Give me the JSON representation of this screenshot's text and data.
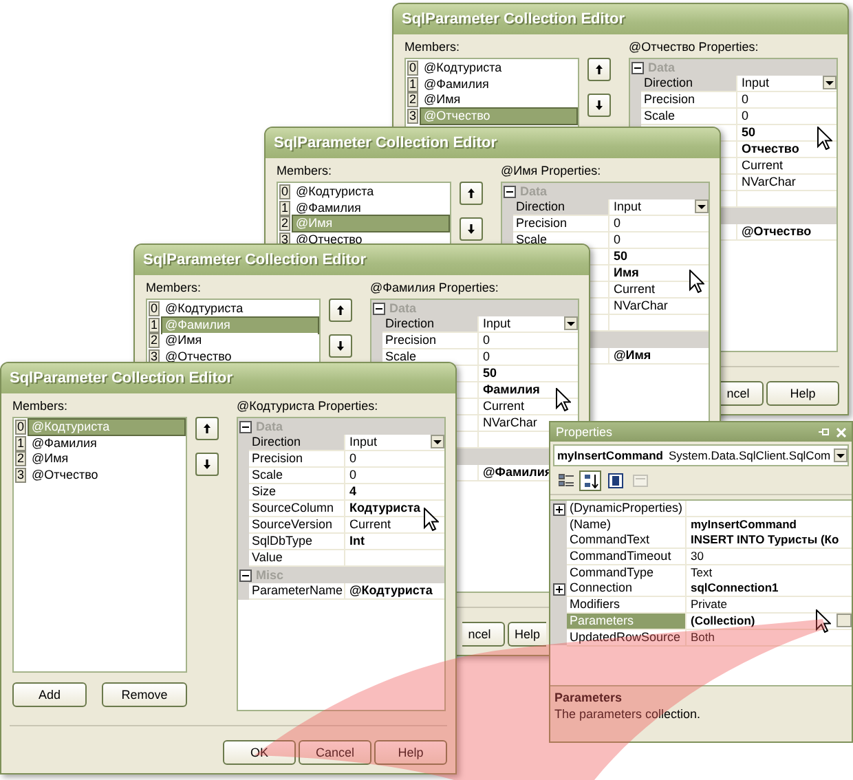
{
  "editors": [
    {
      "title": "SqlParameter Collection Editor",
      "members_label": "Members:",
      "members": [
        {
          "index": "0",
          "name": "@Кодтуриста",
          "selected": false
        },
        {
          "index": "1",
          "name": "@Фамилия",
          "selected": false
        },
        {
          "index": "2",
          "name": "@Имя",
          "selected": false
        },
        {
          "index": "3",
          "name": "@Отчество",
          "selected": true
        }
      ],
      "properties_label": "@Отчество Properties:",
      "grid": [
        {
          "kind": "category",
          "name": "Data",
          "expanded": true
        },
        {
          "kind": "dropdown",
          "name": "Direction",
          "value": "Input",
          "bold": false,
          "selected": true
        },
        {
          "kind": "property",
          "name": "Precision",
          "value": "0",
          "bold": false,
          "selected": false
        },
        {
          "kind": "property",
          "name": "Scale",
          "value": "0",
          "bold": false,
          "selected": false
        },
        {
          "kind": "property",
          "value": "50",
          "bold": true,
          "selected": false
        },
        {
          "kind": "property",
          "value": "Отчество",
          "bold": true,
          "selected": false
        },
        {
          "kind": "property",
          "value": "Current",
          "bold": false,
          "selected": false
        },
        {
          "kind": "property",
          "value": "NVarChar",
          "bold": false,
          "selected": false
        },
        {
          "kind": "property",
          "selected": false
        },
        {
          "kind": "category"
        },
        {
          "kind": "property",
          "value": "@Отчество",
          "bold": true,
          "selected": false
        }
      ],
      "buttons": [
        {
          "label": "ncel",
          "hidden_start": true,
          "hidden_end": false
        },
        {
          "label": "Help",
          "hidden_start": false,
          "hidden_end": false
        }
      ]
    },
    {
      "title": "SqlParameter Collection Editor",
      "members_label": "Members:",
      "members": [
        {
          "index": "0",
          "name": "@Кодтуриста",
          "selected": false
        },
        {
          "index": "1",
          "name": "@Фамилия",
          "selected": false
        },
        {
          "index": "2",
          "name": "@Имя",
          "selected": true
        },
        {
          "index": "3",
          "name": "@Отчество",
          "selected": false
        }
      ],
      "properties_label": "@Имя Properties:",
      "grid": [
        {
          "kind": "category",
          "name": "Data",
          "expanded": true
        },
        {
          "kind": "dropdown",
          "name": "Direction",
          "value": "Input",
          "bold": false,
          "selected": true
        },
        {
          "kind": "property",
          "name": "Precision",
          "value": "0",
          "bold": false,
          "selected": false
        },
        {
          "kind": "property",
          "name": "Scale",
          "value": "0",
          "bold": false,
          "selected": false
        },
        {
          "kind": "property",
          "value": "50",
          "bold": true,
          "selected": false
        },
        {
          "kind": "property",
          "value": "Имя",
          "bold": true,
          "selected": false
        },
        {
          "kind": "property",
          "value": "Current",
          "bold": false,
          "selected": false
        },
        {
          "kind": "property",
          "value": "NVarChar",
          "bold": false,
          "selected": false
        },
        {
          "kind": "property",
          "selected": false
        },
        {
          "kind": "category"
        },
        {
          "kind": "property",
          "value": "@Имя",
          "bold": true,
          "selected": false
        }
      ]
    },
    {
      "title": "SqlParameter Collection Editor",
      "members_label": "Members:",
      "members": [
        {
          "index": "0",
          "name": "@Кодтуриста",
          "selected": false
        },
        {
          "index": "1",
          "name": "@Фамилия",
          "selected": true
        },
        {
          "index": "2",
          "name": "@Имя",
          "selected": false
        },
        {
          "index": "3",
          "name": "@Отчество",
          "selected": false
        }
      ],
      "properties_label": "@Фамилия Properties:",
      "grid": [
        {
          "kind": "category",
          "name": "Data",
          "expanded": true
        },
        {
          "kind": "dropdown",
          "name": "Direction",
          "value": "Input",
          "bold": false,
          "selected": true
        },
        {
          "kind": "property",
          "name": "Precision",
          "value": "0",
          "bold": false,
          "selected": false
        },
        {
          "kind": "property",
          "name": "Scale",
          "value": "0",
          "bold": false,
          "selected": false
        },
        {
          "kind": "property",
          "value": "50",
          "bold": true,
          "selected": false
        },
        {
          "kind": "property",
          "value": "Фамилия",
          "bold": true,
          "selected": false
        },
        {
          "kind": "property",
          "value": "Current",
          "bold": false,
          "selected": false
        },
        {
          "kind": "property",
          "value": "NVarChar",
          "bold": false,
          "selected": false
        },
        {
          "kind": "property",
          "selected": false
        },
        {
          "kind": "category"
        },
        {
          "kind": "property",
          "value": "@Фамилия",
          "bold": true,
          "selected": false
        }
      ],
      "buttons": [
        {
          "label": "ncel",
          "hidden_start": true,
          "hidden_end": false
        },
        {
          "label": "Help",
          "hidden_start": false,
          "hidden_end": true
        }
      ]
    },
    {
      "title": "SqlParameter Collection Editor",
      "members_label": "Members:",
      "members": [
        {
          "index": "0",
          "name": "@Кодтуриста",
          "selected": true
        },
        {
          "index": "1",
          "name": "@Фамилия",
          "selected": false
        },
        {
          "index": "2",
          "name": "@Имя",
          "selected": false
        },
        {
          "index": "3",
          "name": "@Отчество",
          "selected": false
        }
      ],
      "list_buttons": [
        "Add",
        "Remove"
      ],
      "properties_label": "@Кодтуриста Properties:",
      "grid": [
        {
          "kind": "category",
          "name": "Data",
          "expanded": true
        },
        {
          "kind": "dropdown",
          "name": "Direction",
          "value": "Input",
          "bold": false,
          "selected": true
        },
        {
          "kind": "property",
          "name": "Precision",
          "value": "0",
          "bold": false,
          "selected": false
        },
        {
          "kind": "property",
          "name": "Scale",
          "value": "0",
          "bold": false,
          "selected": false
        },
        {
          "kind": "property",
          "name": "Size",
          "value": "4",
          "bold": true,
          "selected": false
        },
        {
          "kind": "property",
          "name": "SourceColumn",
          "value": "Кодтуриста",
          "bold": true,
          "selected": false
        },
        {
          "kind": "property",
          "name": "SourceVersion",
          "value": "Current",
          "bold": false,
          "selected": false
        },
        {
          "kind": "property",
          "name": "SqlDbType",
          "value": "Int",
          "bold": true,
          "selected": false
        },
        {
          "kind": "property",
          "name": "Value",
          "selected": false
        },
        {
          "kind": "category",
          "name": "Misc",
          "expanded": true
        },
        {
          "kind": "property",
          "name": "ParameterName",
          "value": "@Кодтуриста",
          "bold": true,
          "selected": false
        }
      ],
      "buttons": [
        {
          "label": "OK",
          "hidden_start": false,
          "hidden_end": false
        },
        {
          "label": "Cancel",
          "hidden_start": false,
          "hidden_end": false
        },
        {
          "label": "Help",
          "hidden_start": false,
          "hidden_end": false
        }
      ]
    }
  ],
  "properties_window": {
    "title": "Properties",
    "object_name": "myInsertCommand",
    "object_type": "System.Data.SqlClient.SqlCom",
    "toolbar": [
      {
        "kind": "categorized",
        "selected": false,
        "disabled": false
      },
      {
        "kind": "alphabetical",
        "selected": true,
        "disabled": false
      },
      {
        "kind": "properties",
        "selected": false,
        "disabled": false
      },
      {
        "kind": "events",
        "selected": false,
        "disabled": true
      }
    ],
    "rows": [
      {
        "kind": "property",
        "name": "(DynamicProperties)",
        "bold": false,
        "expandable": true,
        "selected": false
      },
      {
        "kind": "property",
        "name": "(Name)",
        "value": "myInsertCommand",
        "bold": true,
        "expandable": false,
        "selected": false
      },
      {
        "kind": "property",
        "name": "CommandText",
        "value": "INSERT INTO Туристы (Ко",
        "bold": true,
        "expandable": false,
        "selected": false
      },
      {
        "kind": "property",
        "name": "CommandTimeout",
        "value": "30",
        "bold": false,
        "expandable": false,
        "selected": false
      },
      {
        "kind": "property",
        "name": "CommandType",
        "value": "Text",
        "bold": false,
        "expandable": false,
        "selected": false
      },
      {
        "kind": "property",
        "name": "Connection",
        "value": "sqlConnection1",
        "bold": true,
        "expandable": true,
        "selected": false
      },
      {
        "kind": "property",
        "name": "Modifiers",
        "value": "Private",
        "bold": false,
        "expandable": false,
        "selected": false
      },
      {
        "kind": "collection",
        "name": "Parameters",
        "value": "(Collection)",
        "bold": true,
        "expandable": false,
        "selected": true
      },
      {
        "kind": "property",
        "name": "UpdatedRowSource",
        "value": "Both",
        "bold": false,
        "expandable": false,
        "selected": false
      }
    ],
    "description": {
      "title": "Parameters",
      "text": "The parameters collection."
    }
  }
}
